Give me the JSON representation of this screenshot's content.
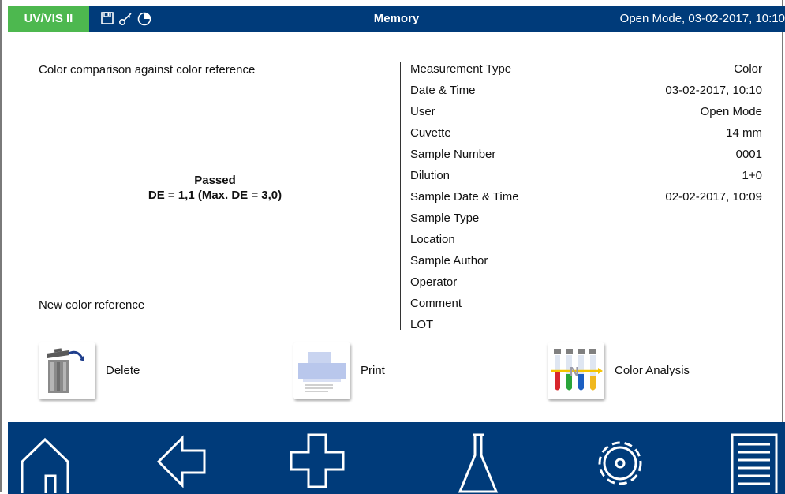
{
  "header": {
    "model": "UV/VIS II",
    "title": "Memory",
    "status": "Open Mode, 03-02-2017, 10:10",
    "icons": [
      "save-icon",
      "key-icon",
      "timer-icon"
    ]
  },
  "left": {
    "description": "Color comparison against color reference",
    "result_status": "Passed",
    "result_value": "DE = 1,1 (Max. DE = 3,0)",
    "new_reference": "New color reference"
  },
  "details": [
    {
      "label": "Measurement Type",
      "value": "Color"
    },
    {
      "label": "Date & Time",
      "value": "03-02-2017, 10:10"
    },
    {
      "label": "User",
      "value": "Open Mode"
    },
    {
      "label": "Cuvette",
      "value": "14 mm"
    },
    {
      "label": "Sample Number",
      "value": "0001"
    },
    {
      "label": "Dilution",
      "value": "1+0"
    },
    {
      "label": "Sample Date & Time",
      "value": "02-02-2017, 10:09"
    },
    {
      "label": "Sample Type",
      "value": ""
    },
    {
      "label": "Location",
      "value": ""
    },
    {
      "label": "Sample Author",
      "value": ""
    },
    {
      "label": "Operator",
      "value": ""
    },
    {
      "label": "Comment",
      "value": ""
    },
    {
      "label": "LOT",
      "value": ""
    }
  ],
  "actions": {
    "delete": "Delete",
    "print": "Print",
    "color_analysis": "Color Analysis"
  },
  "nav": [
    "home-icon",
    "back-icon",
    "add-icon",
    "flask-icon",
    "settings-icon",
    "menu-icon"
  ],
  "colors": {
    "header_blue": "#003b7a",
    "model_green": "#4db84f"
  }
}
